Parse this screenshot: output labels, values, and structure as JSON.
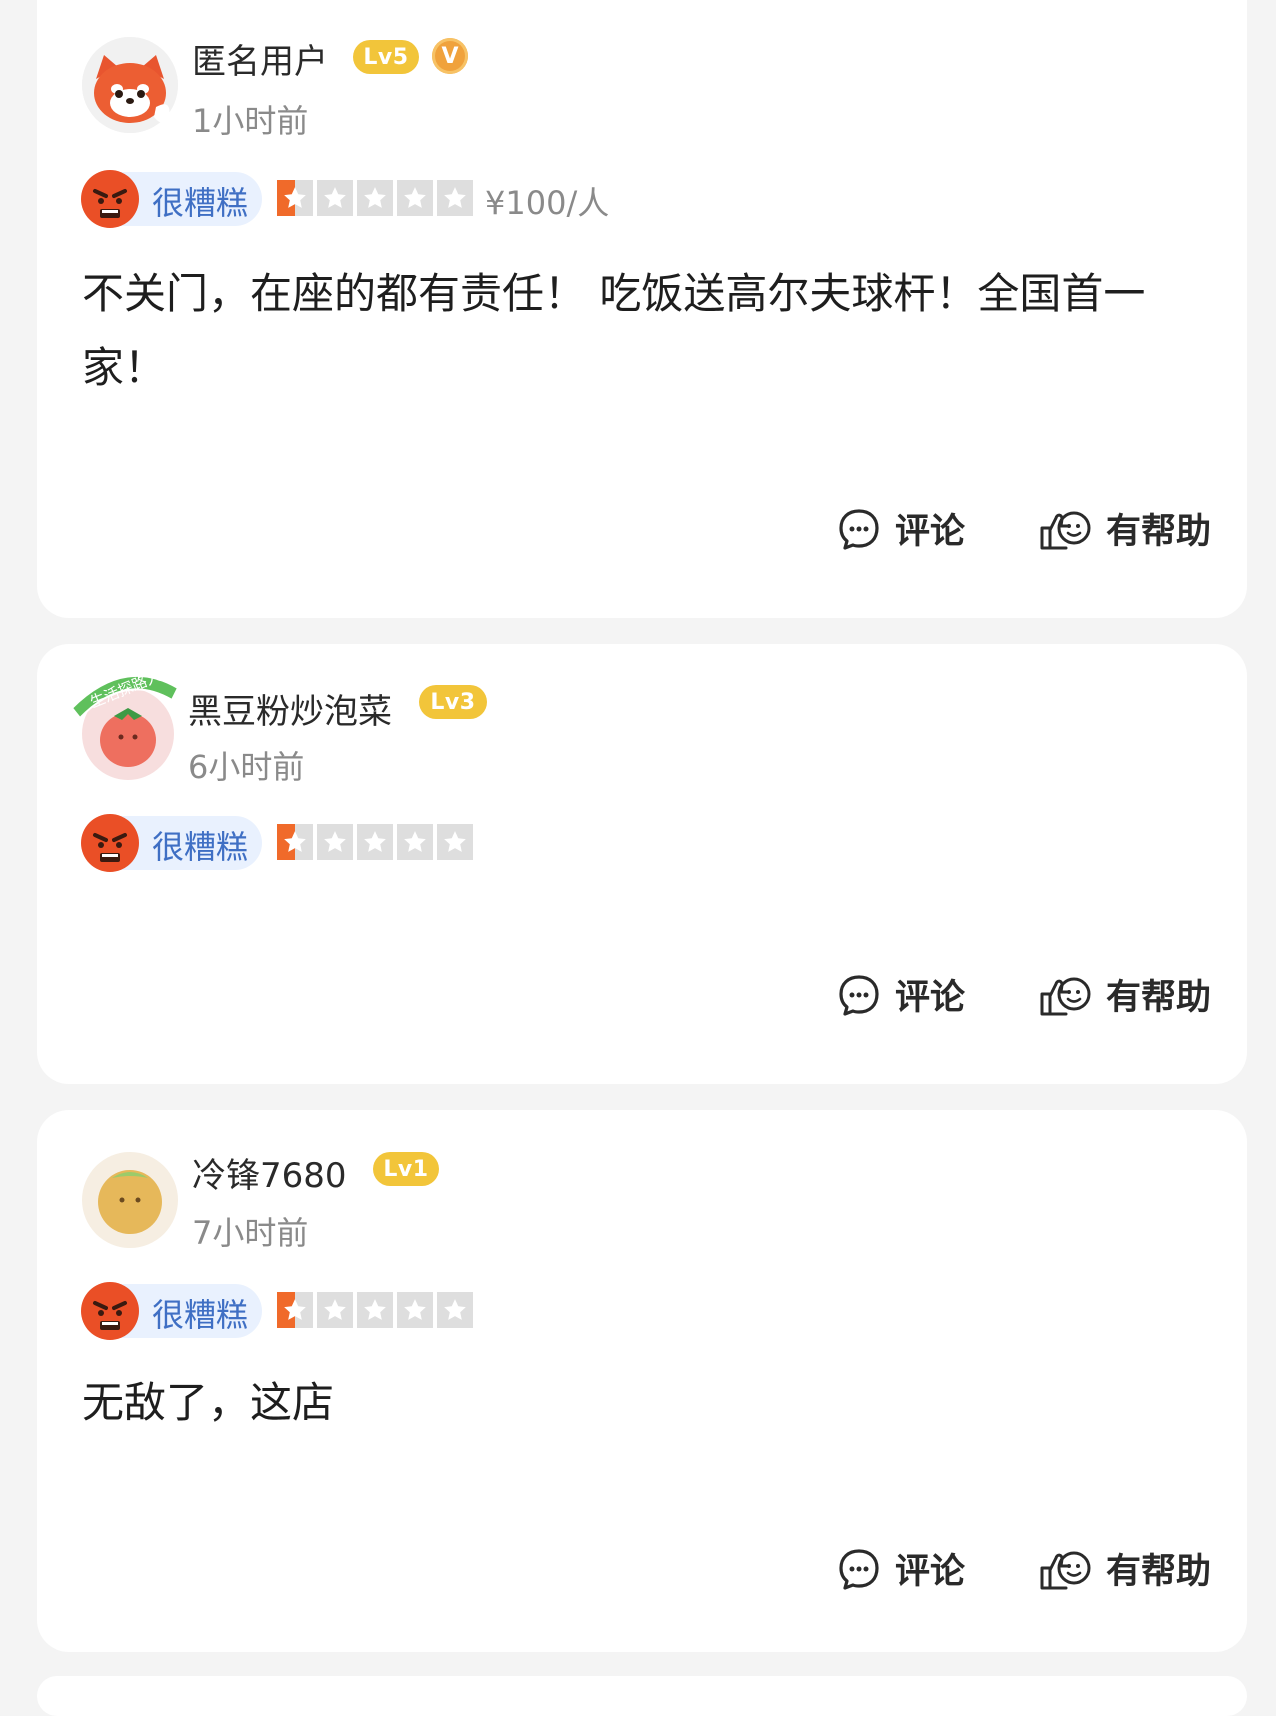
{
  "colors": {
    "background": "#f4f4f4",
    "card": "#ffffff",
    "level_badge": "#f2c53a",
    "rating_pill": "#e9f1fe",
    "rating_text": "#3f6fc4",
    "star_active": "#f06a2a",
    "star_inactive": "#dedede"
  },
  "reviews": [
    {
      "username": "匿名用户",
      "level": "Lv5",
      "verified_badge": "V",
      "time": "1小时前",
      "avatar_icon": "red-panda-avatar",
      "rating_label": "很糟糕",
      "rating_icon": "angry-face-icon",
      "stars": 0.5,
      "price": "¥100/人",
      "text": "不关门，在座的都有责任！ 吃饭送高尔夫球杆！全国首一家！",
      "comment_label": "评论",
      "helpful_label": "有帮助"
    },
    {
      "username": "黑豆粉炒泡菜",
      "level": "Lv3",
      "avatar_tag": "生活探路人",
      "time": "6小时前",
      "avatar_icon": "tomato-avatar",
      "rating_label": "很糟糕",
      "rating_icon": "angry-face-icon",
      "stars": 0.5,
      "comment_label": "评论",
      "helpful_label": "有帮助"
    },
    {
      "username": "冷锋7680",
      "level": "Lv1",
      "time": "7小时前",
      "avatar_icon": "melon-avatar",
      "rating_label": "很糟糕",
      "rating_icon": "angry-face-icon",
      "stars": 0.5,
      "text": "无敌了，这店",
      "comment_label": "评论",
      "helpful_label": "有帮助"
    }
  ]
}
